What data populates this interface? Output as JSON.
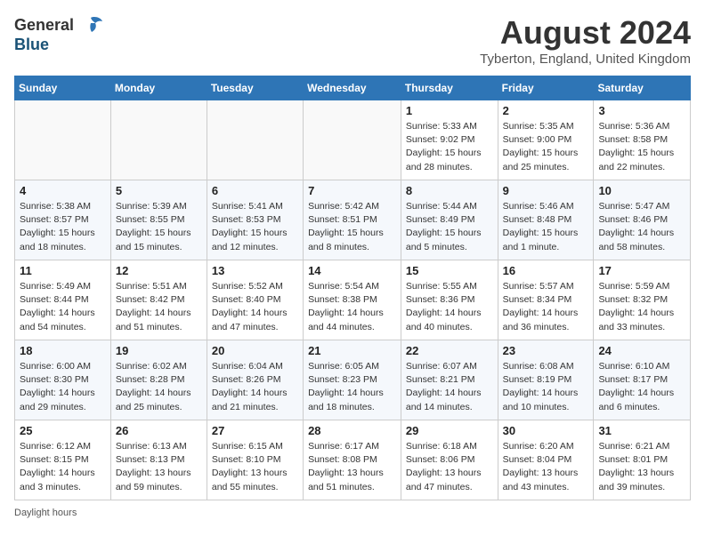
{
  "header": {
    "logo_general": "General",
    "logo_blue": "Blue",
    "month_title": "August 2024",
    "location": "Tyberton, England, United Kingdom"
  },
  "days_of_week": [
    "Sunday",
    "Monday",
    "Tuesday",
    "Wednesday",
    "Thursday",
    "Friday",
    "Saturday"
  ],
  "footer": {
    "label": "Daylight hours"
  },
  "weeks": [
    [
      {
        "day": "",
        "info": ""
      },
      {
        "day": "",
        "info": ""
      },
      {
        "day": "",
        "info": ""
      },
      {
        "day": "",
        "info": ""
      },
      {
        "day": "1",
        "info": "Sunrise: 5:33 AM\nSunset: 9:02 PM\nDaylight: 15 hours\nand 28 minutes."
      },
      {
        "day": "2",
        "info": "Sunrise: 5:35 AM\nSunset: 9:00 PM\nDaylight: 15 hours\nand 25 minutes."
      },
      {
        "day": "3",
        "info": "Sunrise: 5:36 AM\nSunset: 8:58 PM\nDaylight: 15 hours\nand 22 minutes."
      }
    ],
    [
      {
        "day": "4",
        "info": "Sunrise: 5:38 AM\nSunset: 8:57 PM\nDaylight: 15 hours\nand 18 minutes."
      },
      {
        "day": "5",
        "info": "Sunrise: 5:39 AM\nSunset: 8:55 PM\nDaylight: 15 hours\nand 15 minutes."
      },
      {
        "day": "6",
        "info": "Sunrise: 5:41 AM\nSunset: 8:53 PM\nDaylight: 15 hours\nand 12 minutes."
      },
      {
        "day": "7",
        "info": "Sunrise: 5:42 AM\nSunset: 8:51 PM\nDaylight: 15 hours\nand 8 minutes."
      },
      {
        "day": "8",
        "info": "Sunrise: 5:44 AM\nSunset: 8:49 PM\nDaylight: 15 hours\nand 5 minutes."
      },
      {
        "day": "9",
        "info": "Sunrise: 5:46 AM\nSunset: 8:48 PM\nDaylight: 15 hours\nand 1 minute."
      },
      {
        "day": "10",
        "info": "Sunrise: 5:47 AM\nSunset: 8:46 PM\nDaylight: 14 hours\nand 58 minutes."
      }
    ],
    [
      {
        "day": "11",
        "info": "Sunrise: 5:49 AM\nSunset: 8:44 PM\nDaylight: 14 hours\nand 54 minutes."
      },
      {
        "day": "12",
        "info": "Sunrise: 5:51 AM\nSunset: 8:42 PM\nDaylight: 14 hours\nand 51 minutes."
      },
      {
        "day": "13",
        "info": "Sunrise: 5:52 AM\nSunset: 8:40 PM\nDaylight: 14 hours\nand 47 minutes."
      },
      {
        "day": "14",
        "info": "Sunrise: 5:54 AM\nSunset: 8:38 PM\nDaylight: 14 hours\nand 44 minutes."
      },
      {
        "day": "15",
        "info": "Sunrise: 5:55 AM\nSunset: 8:36 PM\nDaylight: 14 hours\nand 40 minutes."
      },
      {
        "day": "16",
        "info": "Sunrise: 5:57 AM\nSunset: 8:34 PM\nDaylight: 14 hours\nand 36 minutes."
      },
      {
        "day": "17",
        "info": "Sunrise: 5:59 AM\nSunset: 8:32 PM\nDaylight: 14 hours\nand 33 minutes."
      }
    ],
    [
      {
        "day": "18",
        "info": "Sunrise: 6:00 AM\nSunset: 8:30 PM\nDaylight: 14 hours\nand 29 minutes."
      },
      {
        "day": "19",
        "info": "Sunrise: 6:02 AM\nSunset: 8:28 PM\nDaylight: 14 hours\nand 25 minutes."
      },
      {
        "day": "20",
        "info": "Sunrise: 6:04 AM\nSunset: 8:26 PM\nDaylight: 14 hours\nand 21 minutes."
      },
      {
        "day": "21",
        "info": "Sunrise: 6:05 AM\nSunset: 8:23 PM\nDaylight: 14 hours\nand 18 minutes."
      },
      {
        "day": "22",
        "info": "Sunrise: 6:07 AM\nSunset: 8:21 PM\nDaylight: 14 hours\nand 14 minutes."
      },
      {
        "day": "23",
        "info": "Sunrise: 6:08 AM\nSunset: 8:19 PM\nDaylight: 14 hours\nand 10 minutes."
      },
      {
        "day": "24",
        "info": "Sunrise: 6:10 AM\nSunset: 8:17 PM\nDaylight: 14 hours\nand 6 minutes."
      }
    ],
    [
      {
        "day": "25",
        "info": "Sunrise: 6:12 AM\nSunset: 8:15 PM\nDaylight: 14 hours\nand 3 minutes."
      },
      {
        "day": "26",
        "info": "Sunrise: 6:13 AM\nSunset: 8:13 PM\nDaylight: 13 hours\nand 59 minutes."
      },
      {
        "day": "27",
        "info": "Sunrise: 6:15 AM\nSunset: 8:10 PM\nDaylight: 13 hours\nand 55 minutes."
      },
      {
        "day": "28",
        "info": "Sunrise: 6:17 AM\nSunset: 8:08 PM\nDaylight: 13 hours\nand 51 minutes."
      },
      {
        "day": "29",
        "info": "Sunrise: 6:18 AM\nSunset: 8:06 PM\nDaylight: 13 hours\nand 47 minutes."
      },
      {
        "day": "30",
        "info": "Sunrise: 6:20 AM\nSunset: 8:04 PM\nDaylight: 13 hours\nand 43 minutes."
      },
      {
        "day": "31",
        "info": "Sunrise: 6:21 AM\nSunset: 8:01 PM\nDaylight: 13 hours\nand 39 minutes."
      }
    ]
  ]
}
